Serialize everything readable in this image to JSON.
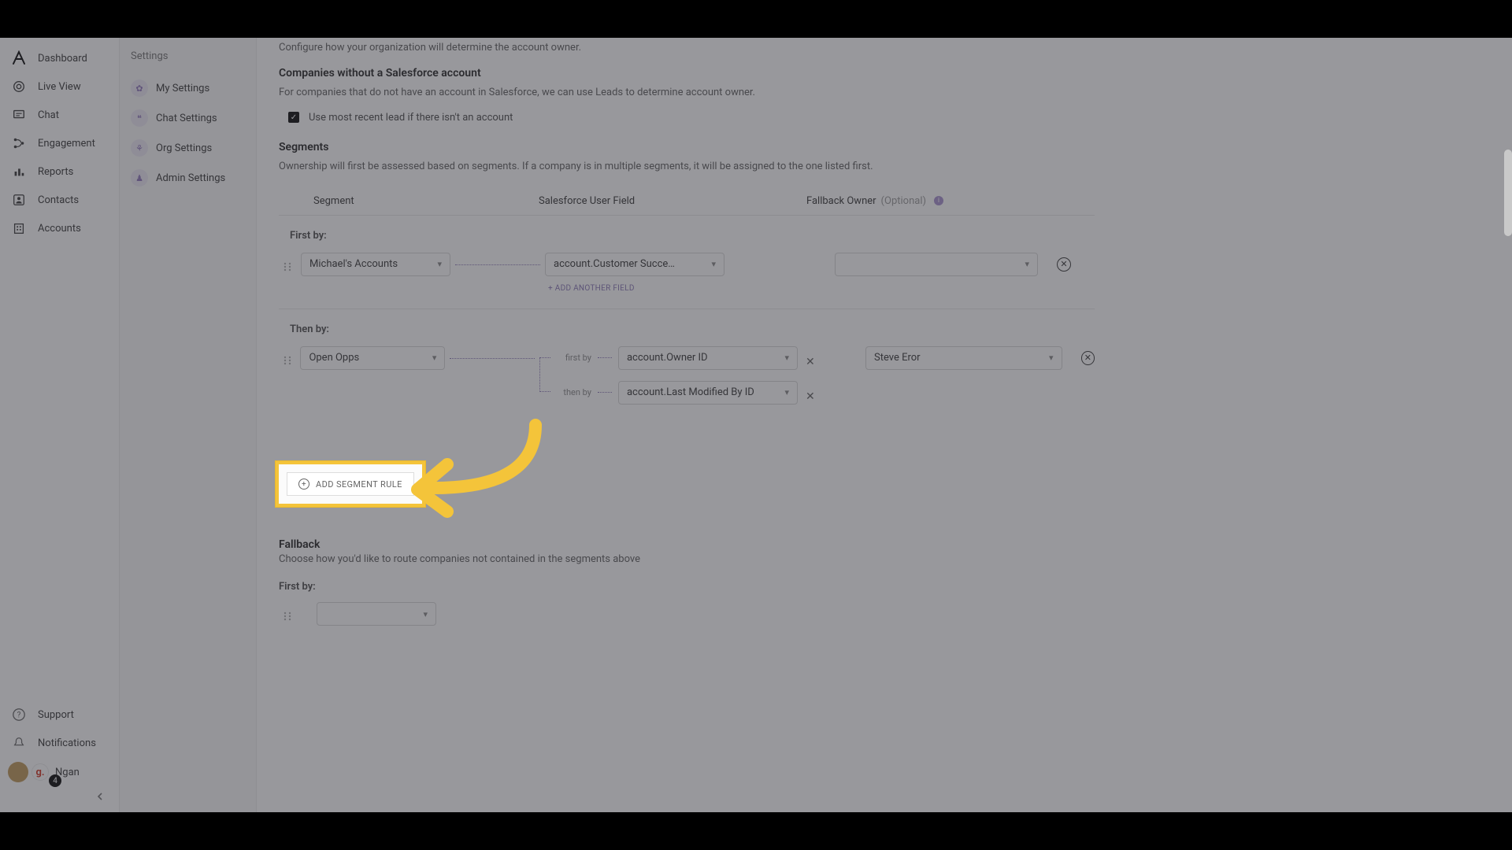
{
  "leftNav": {
    "items": [
      {
        "label": "Dashboard",
        "icon": "logo"
      },
      {
        "label": "Live View",
        "icon": "target"
      },
      {
        "label": "Chat",
        "icon": "chat"
      },
      {
        "label": "Engagement",
        "icon": "branch"
      },
      {
        "label": "Reports",
        "icon": "bar"
      },
      {
        "label": "Contacts",
        "icon": "person"
      },
      {
        "label": "Accounts",
        "icon": "building"
      }
    ],
    "bottom": {
      "support": "Support",
      "notifications": "Notifications",
      "userName": "Ngan",
      "badge": "4",
      "gInitial": "g."
    }
  },
  "subnav": {
    "title": "Settings",
    "items": [
      {
        "label": "My Settings"
      },
      {
        "label": "Chat Settings"
      },
      {
        "label": "Org Settings"
      },
      {
        "label": "Admin Settings"
      }
    ]
  },
  "main": {
    "introLine": "Configure how your organization will determine the account owner.",
    "noSfHeader": "Companies without a Salesforce account",
    "noSfBody": "For companies that do not have an account in Salesforce, we can use Leads to determine account owner.",
    "cbLabel": "Use most recent lead if there isn't an account",
    "segHeader": "Segments",
    "segBody": "Ownership will first be assessed based on segments. If a company is in multiple segments, it will be assigned to the one listed first.",
    "colSegment": "Segment",
    "colField": "Salesforce User Field",
    "colFallback": "Fallback Owner",
    "colOptional": "(Optional)",
    "rule1": {
      "label": "First by:",
      "segment": "Michael's Accounts",
      "field": "account.Customer Succe…",
      "addField": "+ ADD ANOTHER FIELD",
      "fallback": ""
    },
    "rule2": {
      "label": "Then by:",
      "segment": "Open Opps",
      "firstByLabel": "first by",
      "field1": "account.Owner ID",
      "thenByLabel": "then by",
      "field2": "account.Last Modified By ID",
      "fallback": "Steve Eror"
    },
    "addSegBtn": "ADD SEGMENT RULE",
    "fallbackHeader": "Fallback",
    "fallbackBody": "Choose how you'd like to route companies not contained in the segments above",
    "fallbackFirstBy": "First by:"
  }
}
